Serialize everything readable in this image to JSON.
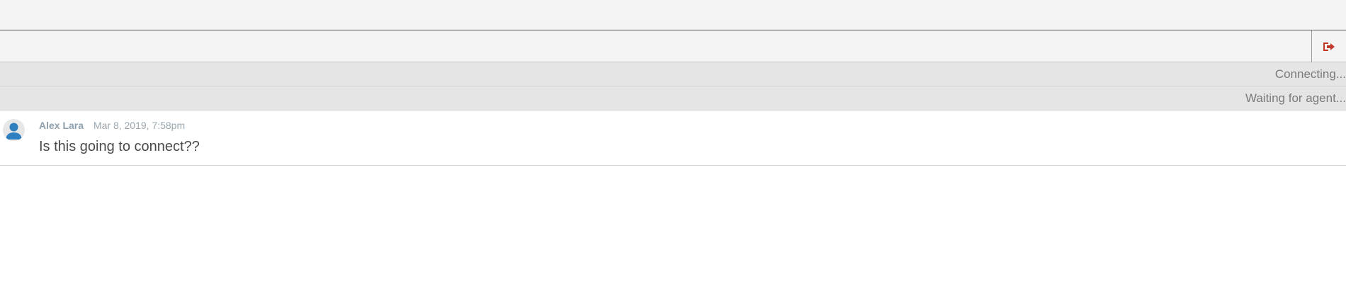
{
  "header": {
    "end_chat_icon": "sign-out-icon",
    "accent_color": "#c0392b"
  },
  "status": {
    "connecting": "Connecting...",
    "waiting": "Waiting for agent..."
  },
  "messages": [
    {
      "author": "Alex Lara",
      "timestamp": "Mar 8, 2019, 7:58pm",
      "text": "Is this going to connect??",
      "avatar_icon": "user-avatar-icon"
    }
  ]
}
